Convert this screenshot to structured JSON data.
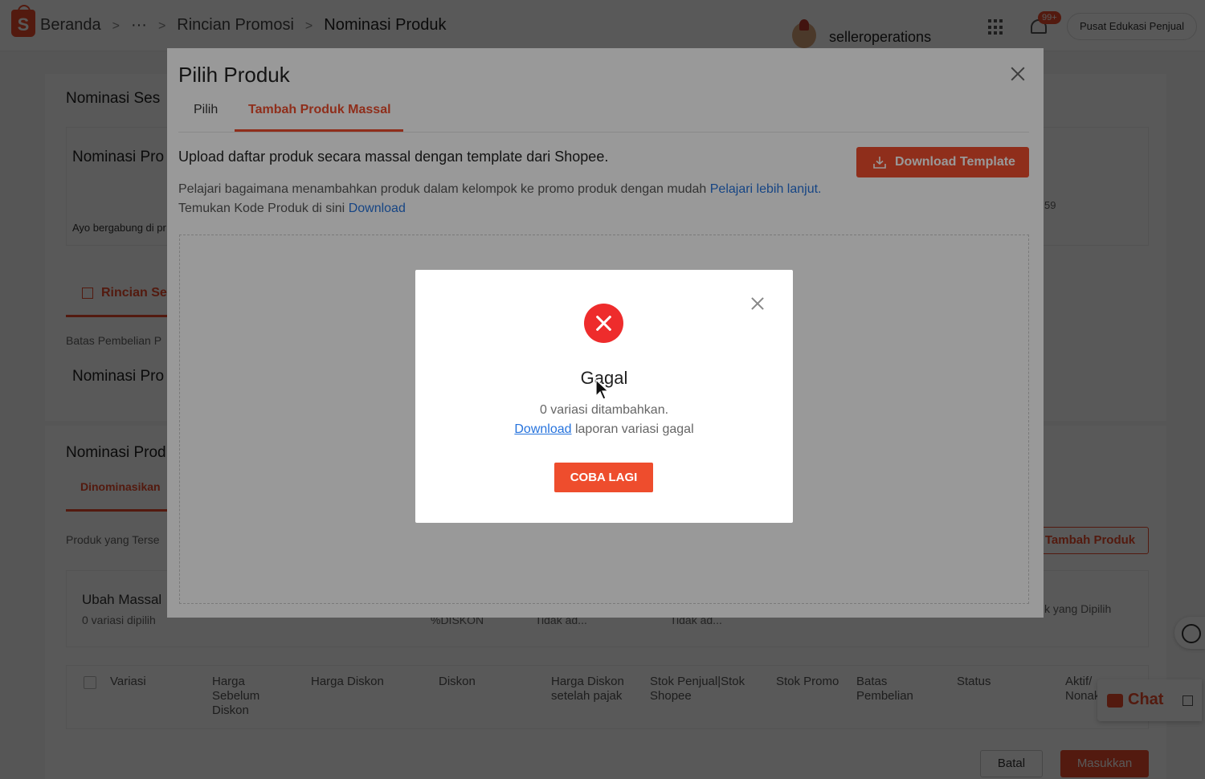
{
  "topbar": {
    "breadcrumbs": [
      "Beranda",
      "···",
      "Rincian Promosi",
      "Nominasi Produk"
    ],
    "username": "selleroperations",
    "notif_badge": "99+",
    "edu_button": "Pusat Edukasi Penjual"
  },
  "background": {
    "section1_title": "Nominasi Ses",
    "card_title": "Nominasi Pro",
    "card_text": "Ayo bergabung di pr",
    "card_side_value": "59",
    "rincian_tab": "Rincian Se",
    "batas_label": "Batas Pembelian P",
    "nominasi_label": "Nominasi Pro",
    "section2_title": "Nominasi Prod",
    "dinominasikan_tab": "Dinominasikan",
    "produk_terse": "Produk yang Terse",
    "tambah_produk": "Tambah Produk",
    "ubah_massal": "Ubah Massal",
    "variasi_dipilih": "0 variasi dipilih",
    "produk_dipilih": "k yang Dipilih",
    "diskon_hint": "%DISKON",
    "tidak_ada_1": "Tidak ad...",
    "tidak_ada_2": "Tidak ad...",
    "columns": {
      "variasi": "Variasi",
      "harga_sebelum": "Harga Sebelum Diskon",
      "harga_diskon": "Harga Diskon",
      "diskon": "Diskon",
      "harga_pajak": "Harga Diskon setelah pajak",
      "stok_penjual": "Stok Penjual|Stok Shopee",
      "stok_promo": "Stok Promo",
      "batas_pembelian": "Batas Pembelian",
      "status": "Status",
      "aktif": "Aktif/ Nonaktif"
    },
    "batal": "Batal",
    "masukkan": "Masukkan",
    "chat": "Chat"
  },
  "pilih_modal": {
    "title": "Pilih Produk",
    "tabs": [
      "Pilih",
      "Tambah Produk Massal"
    ],
    "heading": "Upload daftar produk secara massal dengan template dari Shopee.",
    "download_template": "Download Template",
    "desc1": "Pelajari bagaimana menambahkan produk dalam kelompok ke promo produk dengan mudah",
    "desc1_link": "Pelajari lebih lanjut.",
    "desc2": "Temukan Kode Produk di sini",
    "desc2_link": "Download"
  },
  "error_dialog": {
    "title": "Gagal",
    "message": "0 variasi ditambahkan.",
    "download_link": "Download",
    "report_text": "laporan variasi gagal",
    "retry_button": "COBA LAGI"
  },
  "colors": {
    "accent": "#ee4d2d",
    "link": "#2673dd",
    "error": "#ee2c2c"
  }
}
